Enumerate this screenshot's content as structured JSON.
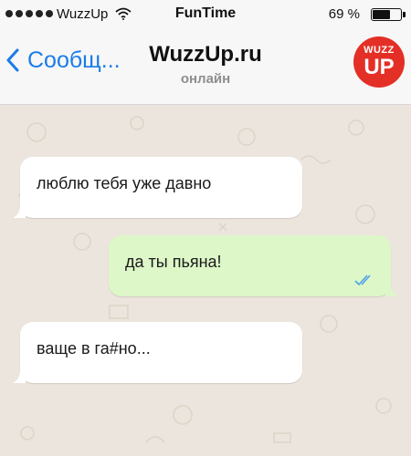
{
  "status_bar": {
    "carrier": "WuzzUp",
    "time": "FunTime",
    "battery": "69 %",
    "battery_level": 0.69
  },
  "header": {
    "back_label": "Сообщ...",
    "title": "WuzzUp.ru",
    "subtitle": "онлайн",
    "avatar_line1": "WUZZ",
    "avatar_line2": "UP"
  },
  "messages": [
    {
      "direction": "incoming",
      "text": "люблю тебя уже давно"
    },
    {
      "direction": "outgoing",
      "text": "да ты пьяна!"
    },
    {
      "direction": "incoming",
      "text": "ваще в га#но..."
    }
  ],
  "colors": {
    "accent": "#1a7ce8",
    "outgoing_bubble": "#ddf7c8",
    "incoming_bubble": "#ffffff",
    "avatar": "#e42f26",
    "read_ticks": "#4da3e8"
  }
}
